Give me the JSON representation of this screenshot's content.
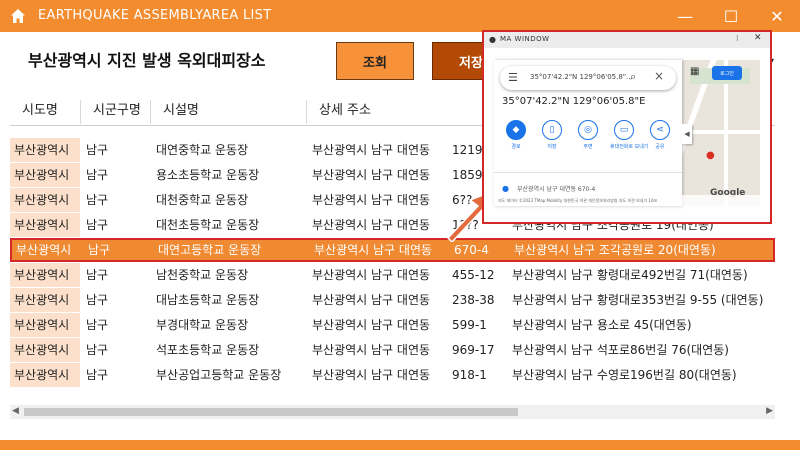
{
  "window": {
    "title": "EARTHQUAKE ASSEMBLYAREA LIST",
    "minimize": "—",
    "maximize": "☐",
    "close": "✕"
  },
  "header": {
    "page_title": "부산광역시 지진 발생 옥외대피장소",
    "search_button": "조회",
    "save_button": "저장",
    "dropdown_arrow": "▾"
  },
  "columns": [
    "시도명",
    "시군구명",
    "시설명",
    "상세 주소"
  ],
  "rows": [
    {
      "sido": "부산광역시",
      "gu": "남구",
      "name": "대연중학교 운동장",
      "addr": "부산광역시 남구 대연동",
      "num": "1219-",
      "road": ""
    },
    {
      "sido": "부산광역시",
      "gu": "남구",
      "name": "용소초등학교 운동장",
      "addr": "부산광역시 남구 대연동",
      "num": "1859-",
      "road": ""
    },
    {
      "sido": "부산광역시",
      "gu": "남구",
      "name": "대천중학교 운동장",
      "addr": "부산광역시 남구 대연동",
      "num": "6??",
      "road": ""
    },
    {
      "sido": "부산광역시",
      "gu": "남구",
      "name": "대천초등학교 운동장",
      "addr": "부산광역시 남구 대연동",
      "num": "1???",
      "road": "부산광역시 남구 조각공원로 19(대연동)"
    },
    {
      "sido": "부산광역시",
      "gu": "남구",
      "name": "대연고등학교 운동장",
      "addr": "부산광역시 남구 대연동",
      "num": "670-4",
      "road": "부산광역시 남구 조각공원로 20(대연동)"
    },
    {
      "sido": "부산광역시",
      "gu": "남구",
      "name": "남천중학교 운동장",
      "addr": "부산광역시 남구 대연동",
      "num": "455-12",
      "road": "부산광역시 남구 황령대로492번길 71(대연동)"
    },
    {
      "sido": "부산광역시",
      "gu": "남구",
      "name": "대남초등학교 운동장",
      "addr": "부산광역시 남구 대연동",
      "num": "238-38",
      "road": "부산광역시 남구 황령대로353번길 9-55 (대연동)"
    },
    {
      "sido": "부산광역시",
      "gu": "남구",
      "name": "부경대학교 운동장",
      "addr": "부산광역시 남구 대연동",
      "num": "599-1",
      "road": "부산광역시 남구 용소로 45(대연동)"
    },
    {
      "sido": "부산광역시",
      "gu": "남구",
      "name": "석포초등학교 운동장",
      "addr": "부산광역시 남구 대연동",
      "num": "969-17",
      "road": "부산광역시 남구 석포로86번길 76(대연동)"
    },
    {
      "sido": "부산광역시",
      "gu": "남구",
      "name": "부산공업고등학교 운동장",
      "addr": "부산광역시 남구 대연동",
      "num": "918-1",
      "road": "부산광역시 남구 수영로196번길 80(대연동)"
    }
  ],
  "map_window": {
    "title": "MA WINDOW",
    "more": "⁝",
    "close": "✕",
    "search_text": "35°07'42.2\"N 129°06'05.8\"...",
    "coords": "35°07'42.2\"N 129°06'05.8\"E",
    "actions": [
      "경로",
      "저장",
      "주변",
      "휴대전화로 보내기",
      "공유"
    ],
    "address": "부산광역시 남구 대연동 670-4",
    "footer": "지도 데이터 ©2023 TMap Mobility  대한민국  약관  개인정보처리방침  지도 의견 보내기  10m",
    "google": "Google",
    "signin": "로그인"
  }
}
